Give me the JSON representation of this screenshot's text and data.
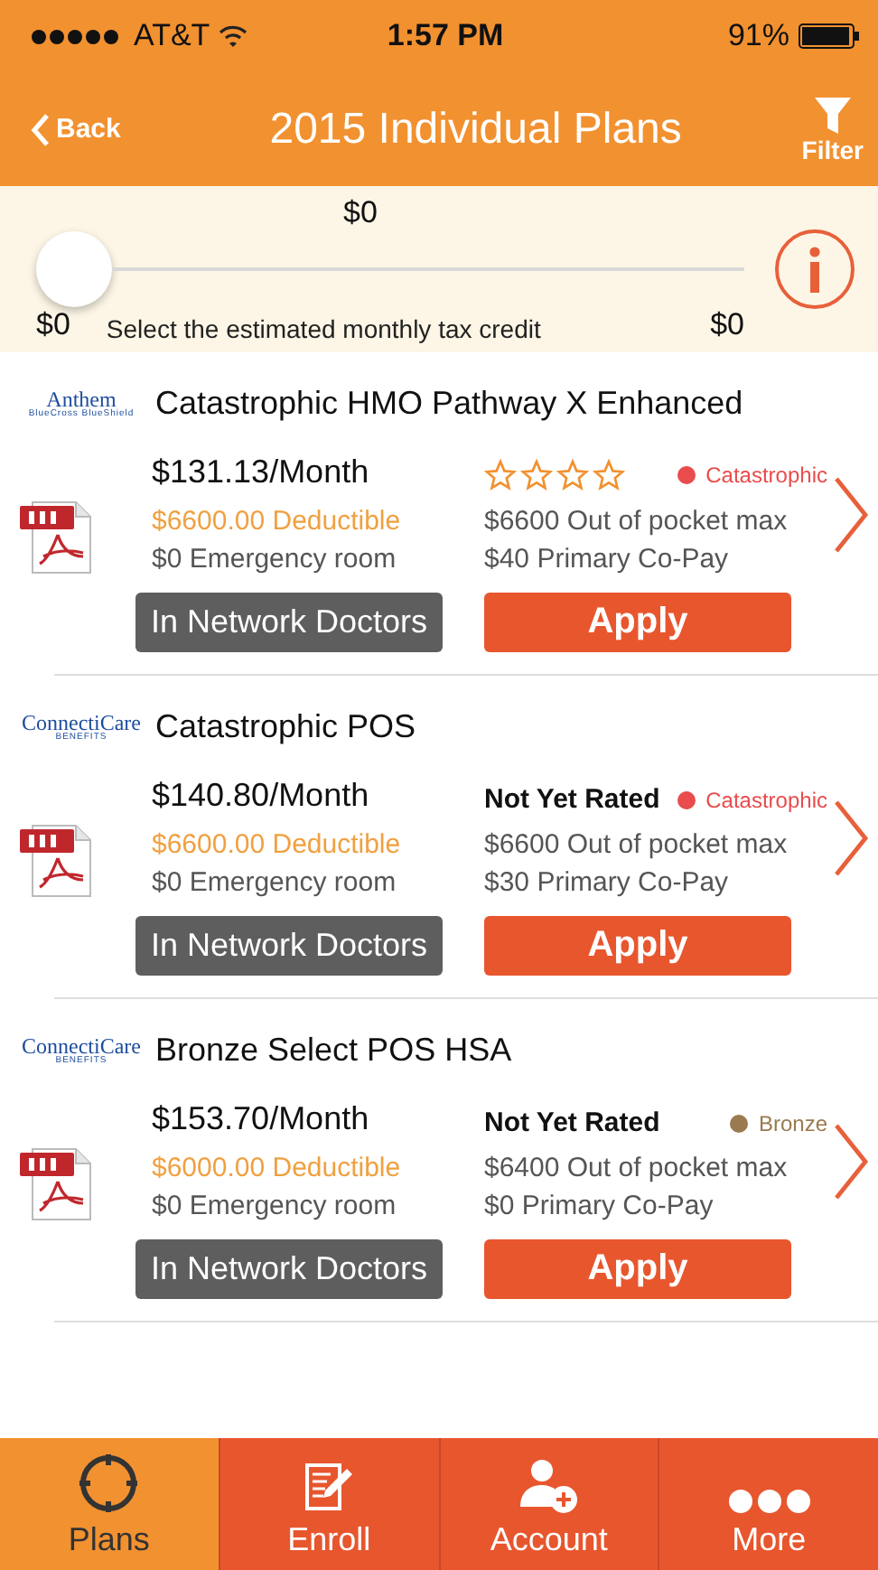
{
  "status_bar": {
    "carrier": "AT&T",
    "time": "1:57 PM",
    "battery": "91%"
  },
  "nav": {
    "back": "Back",
    "title": "2015 Individual Plans",
    "filter": "Filter"
  },
  "tax_credit": {
    "value": "$0",
    "min": "$0",
    "max": "$0",
    "label": "Select the estimated monthly tax credit",
    "level": 0
  },
  "plans": [
    {
      "logo": "Anthem",
      "logo_sub": "BlueCross BlueShield",
      "name": "Catastrophic HMO Pathway X Enhanced",
      "price": "$131.13/Month",
      "stars": 0,
      "metal": "Catastrophic",
      "color": "#e84c4c",
      "deductible": "$6600.00 Deductible",
      "out_of_pocket": "$6600 Out of pocket max",
      "emergency": "$0 Emergency room",
      "copay": "$40 Primary Co-Pay",
      "doctors_button": "In Network Doctors",
      "apply_button": "Apply"
    },
    {
      "logo": "ConnectiCare",
      "logo_sub": "BENEFITS",
      "name": "Catastrophic POS",
      "price": "$140.80/Month",
      "rating": "Not Yet Rated",
      "metal": "Catastrophic",
      "color": "#e84c4c",
      "deductible": "$6600.00 Deductible",
      "out_of_pocket": "$6600 Out of pocket max",
      "emergency": "$0 Emergency room",
      "copay": "$30 Primary Co-Pay",
      "doctors_button": "In Network Doctors",
      "apply_button": "Apply"
    },
    {
      "logo": "ConnectiCare",
      "logo_sub": "BENEFITS",
      "name": "Bronze Select POS HSA",
      "price": "$153.70/Month",
      "rating": "Not Yet Rated",
      "metal": "Bronze",
      "color": "#9a7a4e",
      "deductible": "$6000.00 Deductible",
      "out_of_pocket": "$6400 Out of pocket max",
      "emergency": "$0 Emergency room",
      "copay": "$0 Primary Co-Pay",
      "doctors_button": "In Network Doctors",
      "apply_button": "Apply"
    }
  ],
  "tabs": [
    {
      "label": "Plans",
      "selected": true
    },
    {
      "label": "Enroll",
      "selected": false
    },
    {
      "label": "Account",
      "selected": false
    },
    {
      "label": "More",
      "selected": false
    }
  ]
}
